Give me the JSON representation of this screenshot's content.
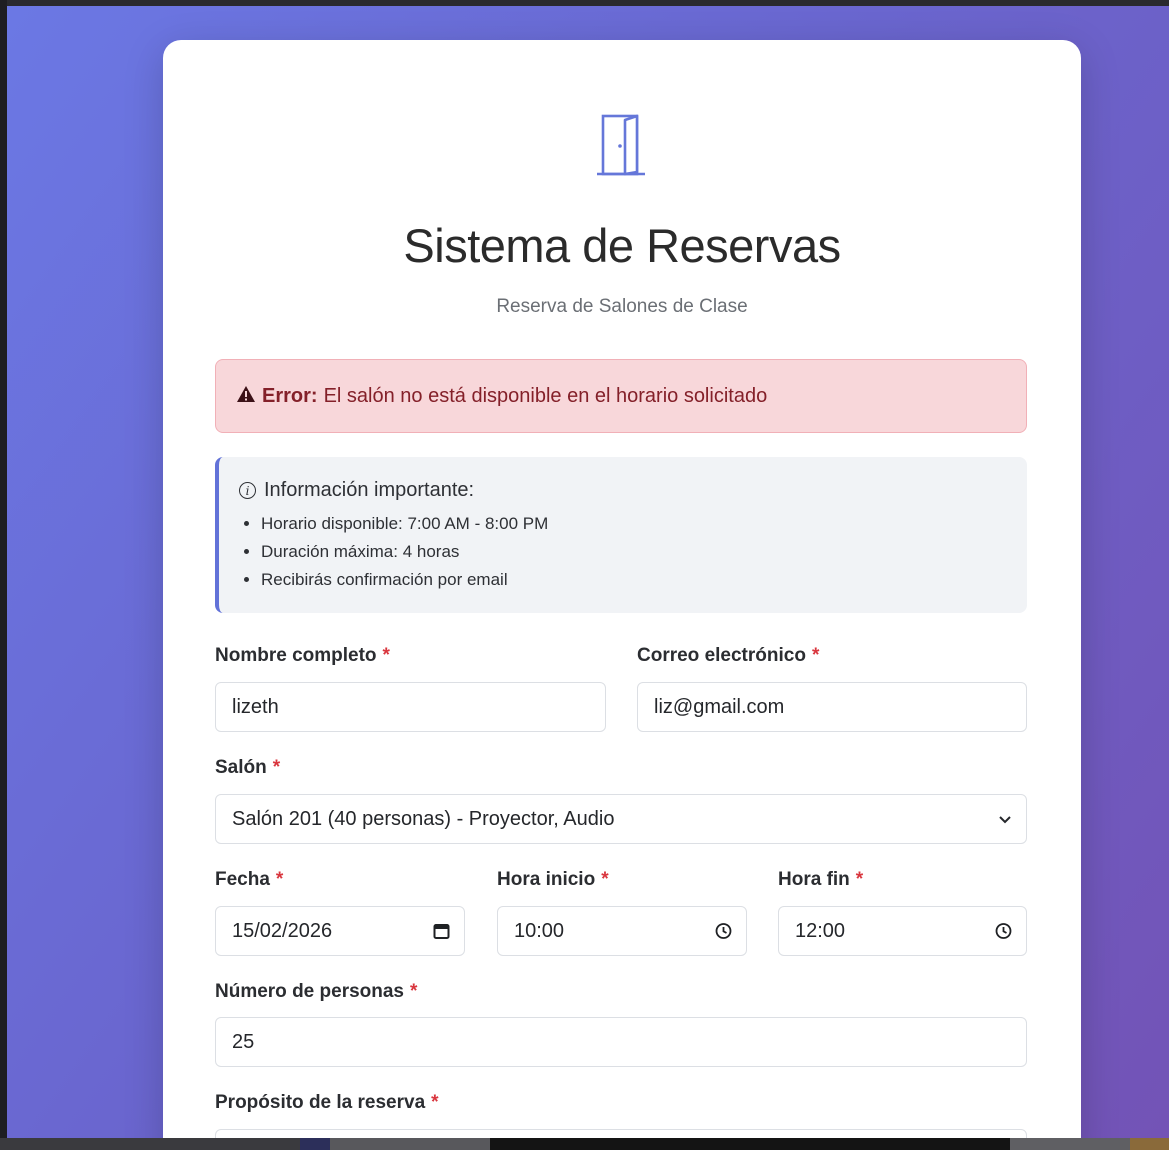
{
  "header": {
    "title": "Sistema de Reservas",
    "subtitle": "Reserva de Salones de Clase"
  },
  "alert": {
    "icon": "warning-icon",
    "label": "Error:",
    "message": "El salón no está disponible en el horario solicitado"
  },
  "info": {
    "title": "Información importante:",
    "items": [
      "Horario disponible: 7:00 AM - 8:00 PM",
      "Duración máxima: 4 horas",
      "Recibirás confirmación por email"
    ]
  },
  "form": {
    "required_mark": "*",
    "nombre": {
      "label": "Nombre completo",
      "value": "lizeth"
    },
    "correo": {
      "label": "Correo electrónico",
      "value": "liz@gmail.com"
    },
    "salon": {
      "label": "Salón",
      "value": "Salón 201 (40 personas) - Proyector, Audio"
    },
    "fecha": {
      "label": "Fecha",
      "value": "15/02/2026"
    },
    "hora_inicio": {
      "label": "Hora inicio",
      "value": "10:00"
    },
    "hora_fin": {
      "label": "Hora fin",
      "value": "12:00"
    },
    "personas": {
      "label": "Número de personas",
      "value": "25"
    },
    "proposito": {
      "label": "Propósito de la reserva",
      "value": ""
    }
  },
  "colors": {
    "accent": "#6272d8",
    "error_bg": "#f8d7da",
    "error_text": "#842029",
    "required": "#d9363e"
  }
}
